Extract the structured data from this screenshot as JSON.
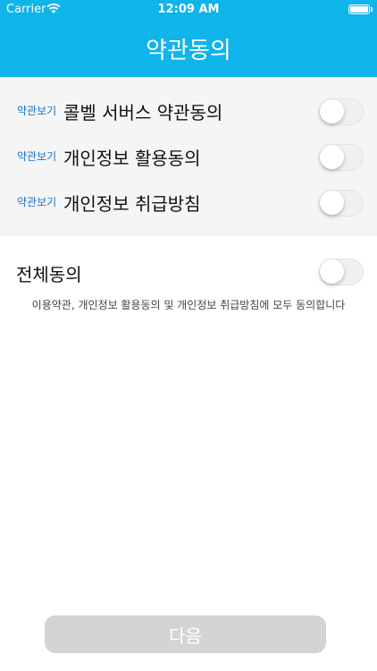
{
  "status_bar": {
    "carrier": "Carrier",
    "time": "12:09 AM",
    "icons": [
      "wifi-icon",
      "battery-icon"
    ]
  },
  "nav": {
    "title": "약관동의"
  },
  "terms": [
    {
      "link": "약관보기",
      "title": "콜벨 서버스 약관동의",
      "checked": false
    },
    {
      "link": "약관보기",
      "title": "개인정보 활용동의",
      "checked": false
    },
    {
      "link": "약관보기",
      "title": "개인정보 취급방침",
      "checked": false
    }
  ],
  "agree_all": {
    "title": "전체동의",
    "checked": false,
    "description": "이용약관, 개인정보 활용동의 및 개인정보 취급방침에 모두 동의합니다"
  },
  "next_button": {
    "label": "다음",
    "enabled": false
  },
  "colors": {
    "header": "#0fb4ea",
    "link": "#1a73c9",
    "terms_bg": "#f5f5f5",
    "button_disabled": "#d4d4d4"
  }
}
